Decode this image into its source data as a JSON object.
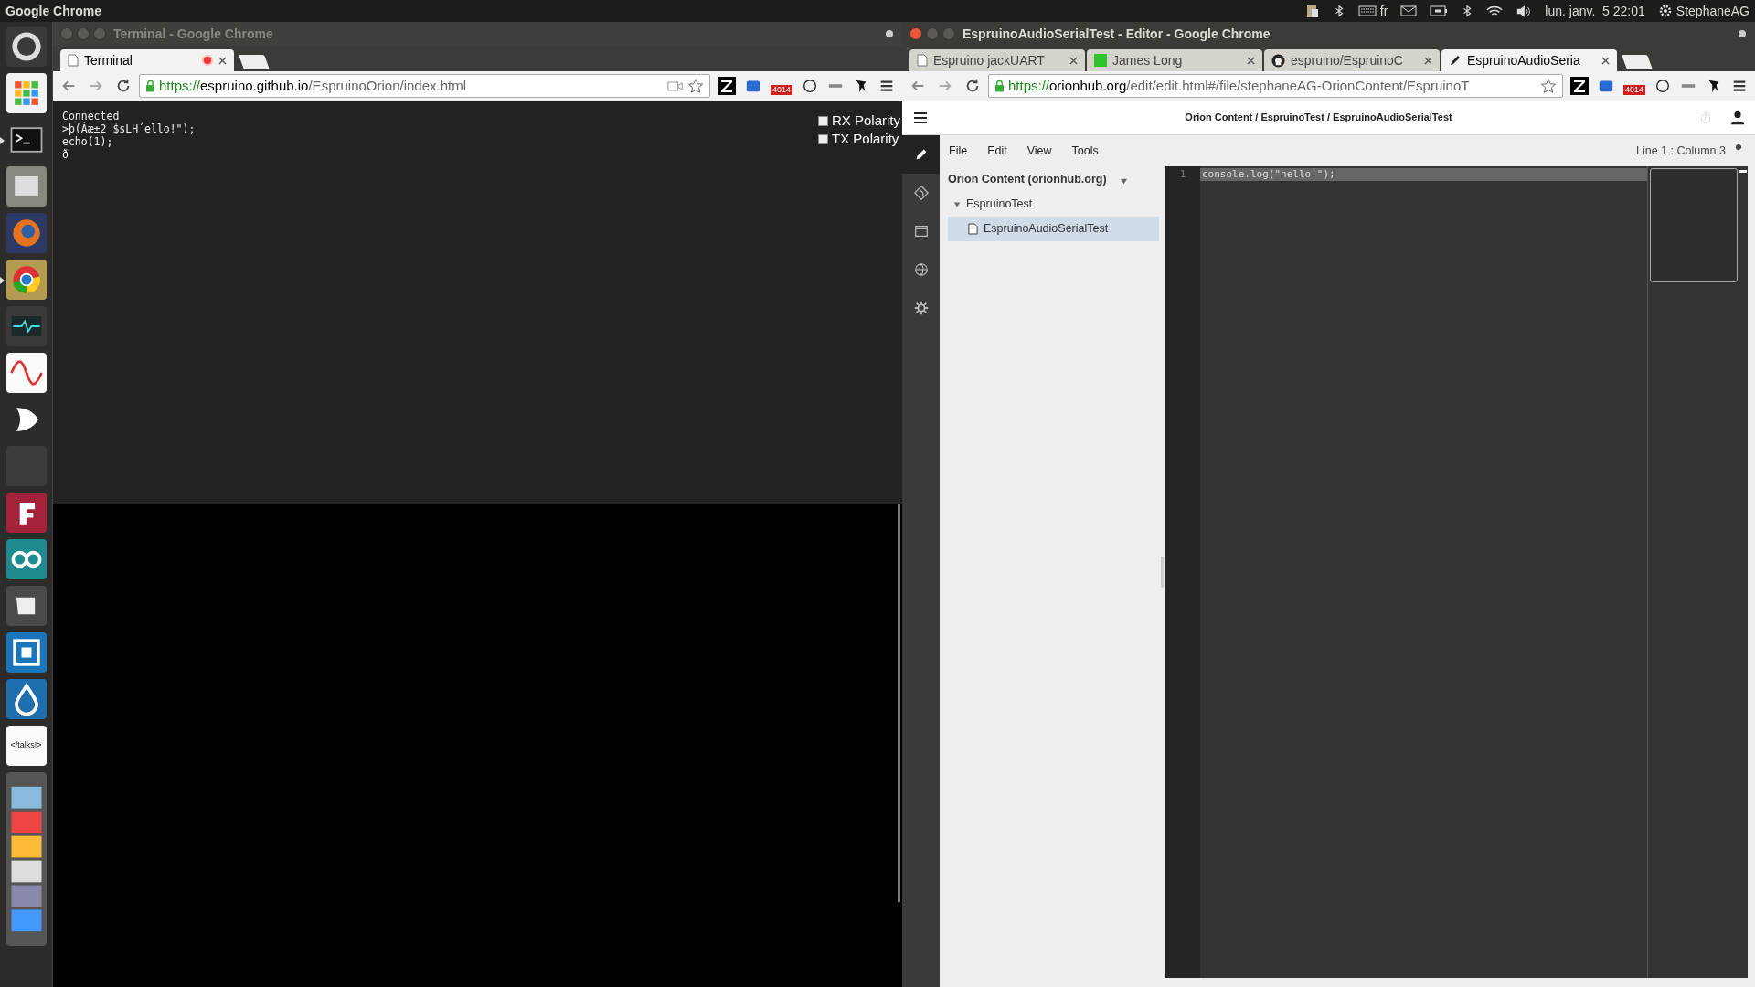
{
  "top_panel": {
    "app_name": "Google Chrome",
    "keyboard_layout": "fr",
    "clock": "lun. janv.  5 22:01",
    "user": "StephaneAG"
  },
  "launcher": [
    {
      "kind": "dash"
    },
    {
      "kind": "apps"
    },
    {
      "kind": "terminal",
      "running": true
    },
    {
      "kind": "files"
    },
    {
      "kind": "firefox"
    },
    {
      "kind": "chrome",
      "running": true
    },
    {
      "kind": "monitor"
    },
    {
      "kind": "wave"
    },
    {
      "kind": "gate"
    },
    {
      "kind": "blank"
    },
    {
      "kind": "flat"
    },
    {
      "kind": "arduino"
    },
    {
      "kind": "cup"
    },
    {
      "kind": "frame"
    },
    {
      "kind": "drop"
    },
    {
      "kind": "talks",
      "label": "</talks!>"
    },
    {
      "kind": "stack"
    }
  ],
  "left_window": {
    "title": "Terminal - Google Chrome",
    "focused": false,
    "tabs": [
      {
        "label": "Terminal",
        "selected": true,
        "recording": true
      }
    ],
    "url": {
      "scheme": "https://",
      "host": "espruino.github.io",
      "path": "/EspruinoOrion/index.html"
    },
    "mail_badge": "4014",
    "terminal_lines": [
      "Connected",
      ">þ(Àæ±2 $sLH´ello!\");",
      "echo(1);",
      "ð"
    ],
    "checkboxes": [
      {
        "label": "RX Polarity",
        "checked": false
      },
      {
        "label": "TX Polarity",
        "checked": false
      }
    ]
  },
  "right_window": {
    "title": "EspruinoAudioSerialTest - Editor - Google Chrome",
    "focused": true,
    "tabs": [
      {
        "label": "Espruino jackUART",
        "selected": false,
        "kind": "page"
      },
      {
        "label": "James Long",
        "selected": false,
        "kind": "square"
      },
      {
        "label": "espruino/EspruinoC",
        "selected": false,
        "kind": "github"
      },
      {
        "label": "EspruinoAudioSeria",
        "selected": true,
        "kind": "pencil"
      }
    ],
    "url": {
      "scheme": "https://",
      "host": "orionhub.org",
      "path": "/edit/edit.html#/file/stephaneAG-OrionContent/EspruinoT"
    },
    "mail_badge": "4014",
    "breadcrumb": "Orion Content / EspruinoTest / EspruinoAudioSerialTest",
    "menus": [
      "File",
      "Edit",
      "View",
      "Tools"
    ],
    "cursor_position": "Line 1 : Column 3",
    "nav": [
      {
        "kind": "pencil",
        "selected": true
      },
      {
        "kind": "git",
        "selected": false
      },
      {
        "kind": "shell",
        "selected": false
      },
      {
        "kind": "globe",
        "selected": false
      },
      {
        "kind": "gear",
        "selected": false
      }
    ],
    "tree": {
      "label": "Orion Content (orionhub.org)",
      "children": [
        {
          "label": "EspruinoTest",
          "expanded": true,
          "children": [
            {
              "label": "EspruinoAudioSerialTest",
              "selected": true
            }
          ]
        }
      ]
    },
    "editor_lines": [
      {
        "number": "1",
        "text": "console.log(\"hello!\");",
        "current": true
      }
    ]
  }
}
